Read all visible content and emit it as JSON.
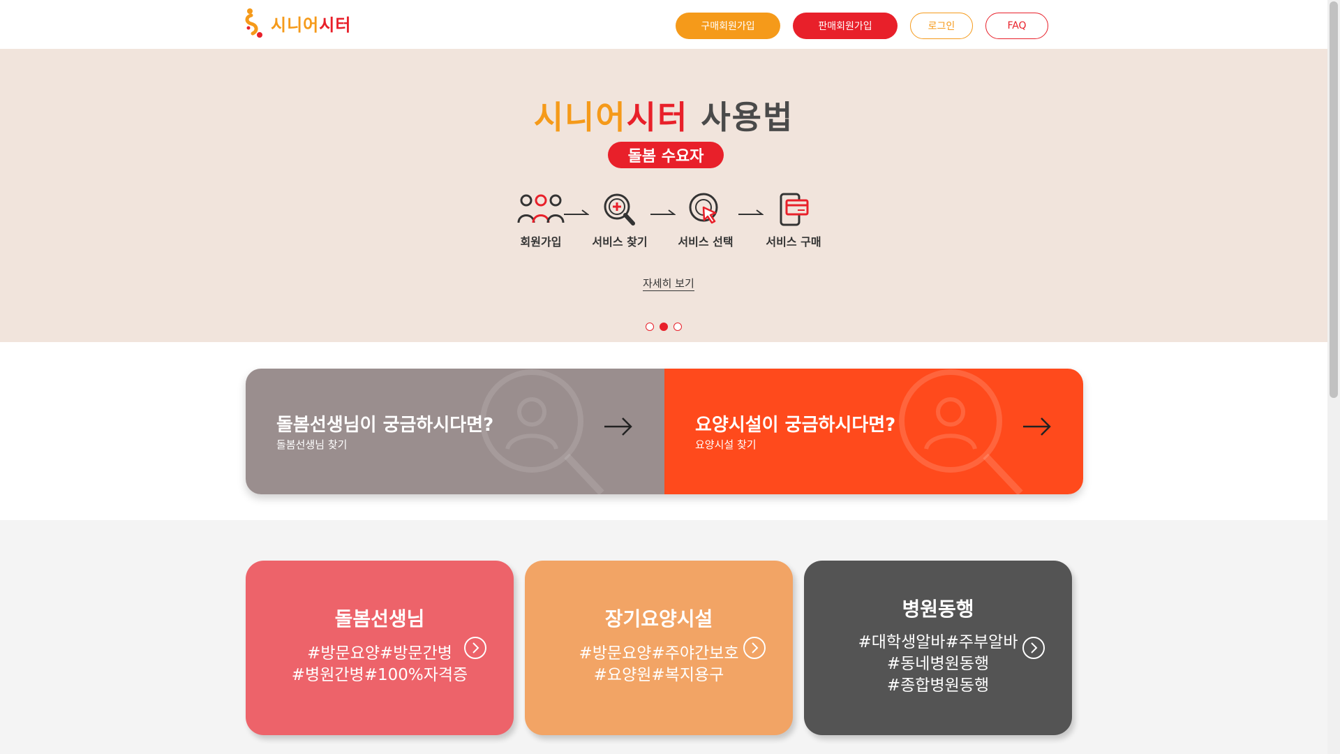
{
  "header": {
    "logo_text_orange": "시니어",
    "logo_text_red": "시터",
    "nav": {
      "buy_label": "구매회원가입",
      "sell_label": "판매회원가입",
      "login_label": "로그인",
      "faq_label": "FAQ"
    }
  },
  "hero": {
    "title_orange": "시니어",
    "title_red": "시터",
    "title_dark": " 사용법",
    "badge": "돌봄 수요자",
    "steps": [
      {
        "label": "회원가입",
        "icon": "people-icon"
      },
      {
        "label": "서비스 찾기",
        "icon": "magnifier-plus-icon"
      },
      {
        "label": "서비스 선택",
        "icon": "target-cursor-icon"
      },
      {
        "label": "서비스 구매",
        "icon": "phone-card-icon"
      }
    ],
    "more_link": "자세히 보기",
    "slides": {
      "count": 3,
      "active_index": 1
    }
  },
  "search_banners": [
    {
      "title": "돌봄선생님이 궁금하시다면?",
      "sub": "돌봄선생님 찾기",
      "color": "#9a8e8e"
    },
    {
      "title": "요양시설이 궁금하시다면?",
      "sub": "요양시설 찾기",
      "color": "#ff4a1c"
    }
  ],
  "categories": [
    {
      "title": "돌봄선생님",
      "tags": [
        "#방문요양#방문간병",
        "#병원간병#100%자격증"
      ],
      "color": "#ed636a"
    },
    {
      "title": "장기요양시설",
      "tags": [
        "#방문요양#주야간보호",
        "#요양원#복지용구"
      ],
      "color": "#f2a465"
    },
    {
      "title": "병원동행",
      "tags": [
        "#대학생알바#주부알바",
        "#동네병원동행",
        "#종합병원동행"
      ],
      "color": "#545454"
    }
  ],
  "colors": {
    "brand_orange": "#f59a1a",
    "brand_red": "#e8202a",
    "hero_bg": "#f1e4dc"
  }
}
